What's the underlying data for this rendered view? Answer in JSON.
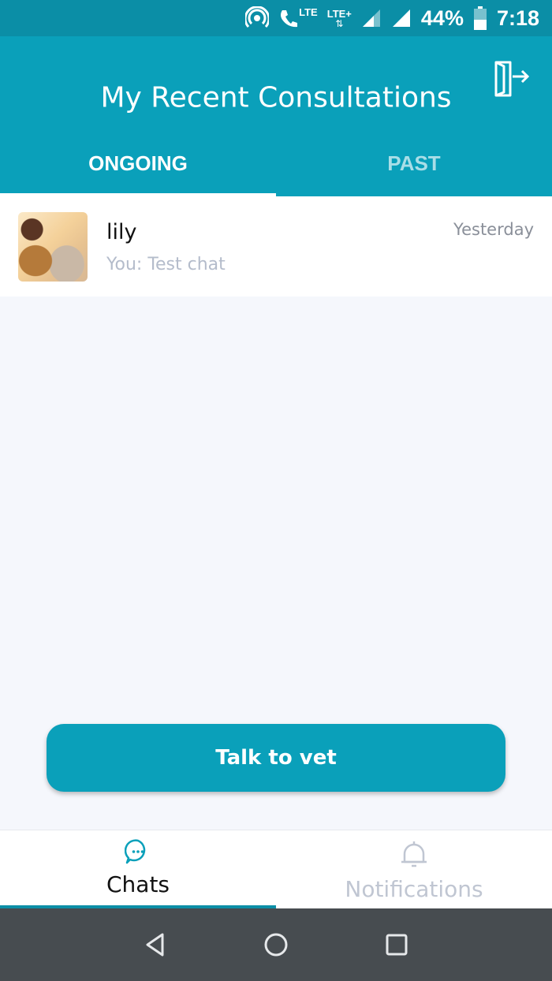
{
  "status_bar": {
    "lte_call": "LTE",
    "lte_plus": "LTE+",
    "battery": "44%",
    "time": "7:18"
  },
  "header": {
    "title": "My Recent Consultations",
    "logout_icon": "logout-icon"
  },
  "tabs": [
    {
      "label": "ONGOING",
      "active": true
    },
    {
      "label": "PAST",
      "active": false
    }
  ],
  "chats": [
    {
      "name": "lily",
      "preview": "You: Test chat",
      "time": "Yesterday"
    }
  ],
  "primary_action": {
    "label": "Talk to vet"
  },
  "bottom_nav": [
    {
      "label": "Chats",
      "icon": "chat-bubble-icon",
      "active": true
    },
    {
      "label": "Notifications",
      "icon": "bell-icon",
      "active": false
    }
  ],
  "colors": {
    "primary": "#0aa0ba",
    "status_bar": "#0b8ea6",
    "background": "#f5f7fc",
    "system_nav": "#474c50"
  }
}
